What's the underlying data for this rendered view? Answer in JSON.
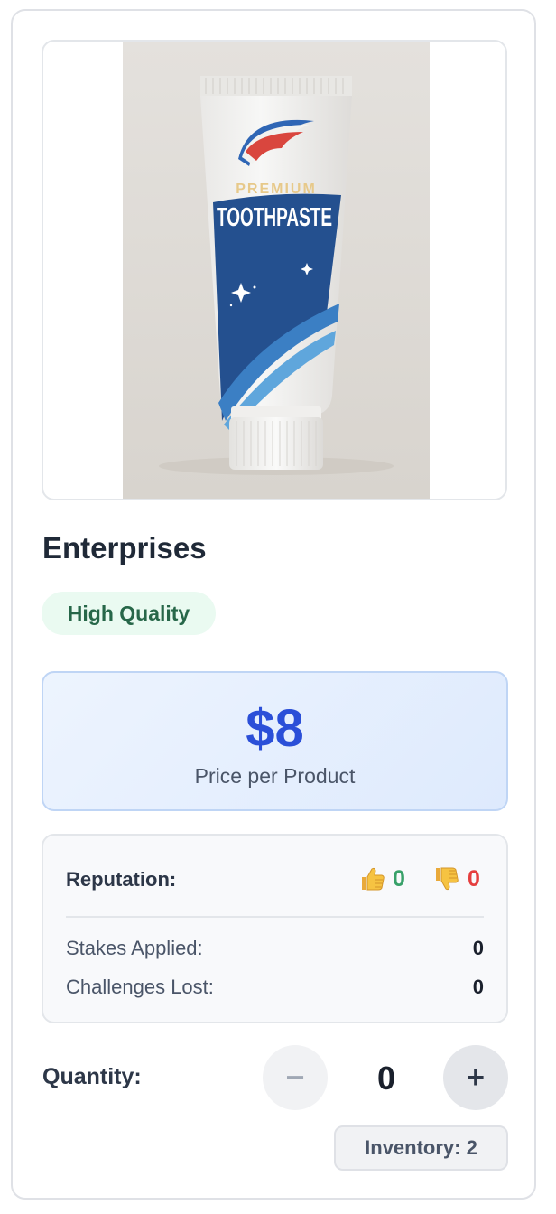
{
  "product": {
    "image_alt": "Premium toothpaste tube",
    "package_text_top": "PREMIUM",
    "package_text_main": "TOOTHPASTE",
    "name": "Enterprises",
    "quality_badge": "High Quality"
  },
  "price": {
    "value": "$8",
    "label": "Price per Product"
  },
  "stats": {
    "reputation_label": "Reputation:",
    "thumbs_up_icon": "thumbs-up-icon",
    "thumbs_up_count": "0",
    "thumbs_down_icon": "thumbs-down-icon",
    "thumbs_down_count": "0",
    "stakes_label": "Stakes Applied:",
    "stakes_value": "0",
    "challenges_label": "Challenges Lost:",
    "challenges_value": "0"
  },
  "quantity": {
    "label": "Quantity:",
    "value": "0",
    "decrement": "−",
    "increment": "+"
  },
  "inventory": {
    "text": "Inventory: 2"
  },
  "colors": {
    "accent_price": "#2b4fd8",
    "quality_green": "#276749",
    "thumbs_up_count": "#38a169",
    "thumbs_down_count": "#e53e3e"
  }
}
